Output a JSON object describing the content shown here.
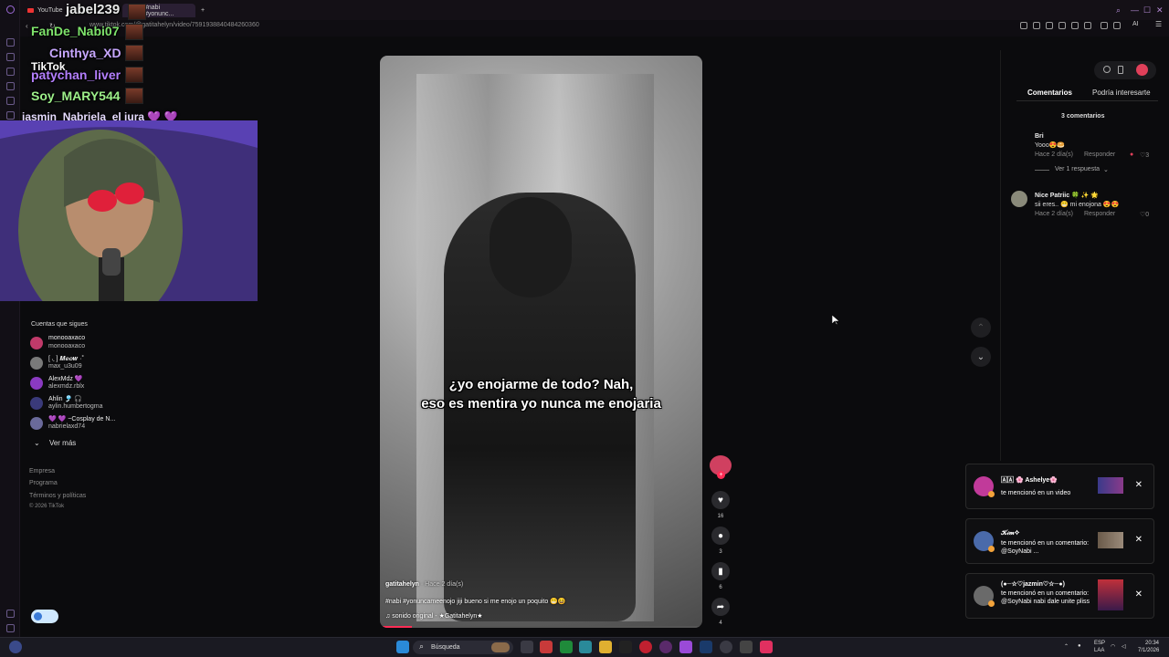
{
  "browser": {
    "tabs": [
      {
        "label": "YouTube",
        "active": false
      },
      {
        "label": "#nabi #yonunc...",
        "active": true
      }
    ],
    "new_tab": "+",
    "url": "www.tiktok.com/@gatitahelyn/video/7591938840484260360",
    "ai_label": "AI"
  },
  "stream": {
    "chat": [
      {
        "name": "jabel239",
        "color": "#ffffff"
      },
      {
        "name": "FanDe_Nabi07",
        "color": "#7ee36b"
      },
      {
        "name": "Cinthya_XD",
        "color": "#c7a7ff"
      },
      {
        "name": "patychan_liver",
        "color": "#b47fff"
      },
      {
        "name": "Soy_MARY544",
        "color": "#9df08a"
      },
      {
        "name": "jasmin_Nabriela_el jura 💜 💜",
        "color": "#e6dcff"
      }
    ],
    "tiktok_logo": "TikTok"
  },
  "sidebar": {
    "following_title": "Cuentas que sigues",
    "accounts": [
      {
        "name": "monooaxaco",
        "handle": "monooaxaco",
        "color": "#c13a6a"
      },
      {
        "name": "[ ◟ ] 𝑴𝒆𝒐𝒘 ·˚",
        "handle": "max_u3u09",
        "color": "#7a7a7a"
      },
      {
        "name": "AlexMdz 💜",
        "handle": "alexmdz.rblx",
        "color": "#8a3ac1"
      },
      {
        "name": "Ahlin 🎐 🎧",
        "handle": "aylin.humbertogma",
        "color": "#3a3a7a"
      },
      {
        "name": "💜 💜 ~Cosplay de N...",
        "handle": "nabrielaxd74",
        "color": "#6a6a9a"
      }
    ],
    "see_more": "Ver más",
    "footer": [
      "Empresa",
      "Programa",
      "Términos y políticas",
      "© 2026 TikTok"
    ]
  },
  "video": {
    "caption_line1": "¿yo enojarme de todo? Nah,",
    "caption_line2": "eso es mentira yo nunca me enojaria",
    "author": "gatitahelyn",
    "posted": "· Hace 2 día(s)",
    "description": "#nabi #yonuncameenojo jiji bueno si me enojo un poquito 😁😆",
    "sound": "sonido original - ★Gatitahelyn★",
    "progress": 0.1
  },
  "actions": {
    "likes": "16",
    "comments": "3",
    "saves": "6",
    "shares": "4"
  },
  "panel": {
    "tabs": [
      "Comentarios",
      "Podría interesarte"
    ],
    "comment_count": "3 comentarios",
    "comments": [
      {
        "name": "Bri",
        "text": "Yooo😍🥯",
        "time": "Hace 2 día(s)",
        "reply": "Responder",
        "likes": "3",
        "replies": "Ver 1 respuesta"
      },
      {
        "name": "Nice Patriic 🍀 ✨ 🌟",
        "text": "sii eres.. 😁 mi enojona 😍😍",
        "time": "Hace 2 día(s)",
        "reply": "Responder",
        "likes": "0"
      }
    ]
  },
  "notifications": [
    {
      "name": "🄰🄰 🌸 Ashelye🌸",
      "text": "te mencionó en un video",
      "color": "#c13a9a"
    },
    {
      "name": "𝒦𝒾𝓂✧",
      "text": "te mencionó en un comentario: @SoyNabi ...",
      "color": "#4a6aaa"
    },
    {
      "name": "(●─☆♡jazmin♡☆─●)",
      "text": "te mencionó en un comentario: @SoyNabi nabi dale unite pliss",
      "color": "#6a6a6a"
    }
  ],
  "taskbar": {
    "search": "Búsqueda",
    "lang": "ESP",
    "region": "LAA",
    "time": "20:34",
    "date": "7/1/2026"
  }
}
